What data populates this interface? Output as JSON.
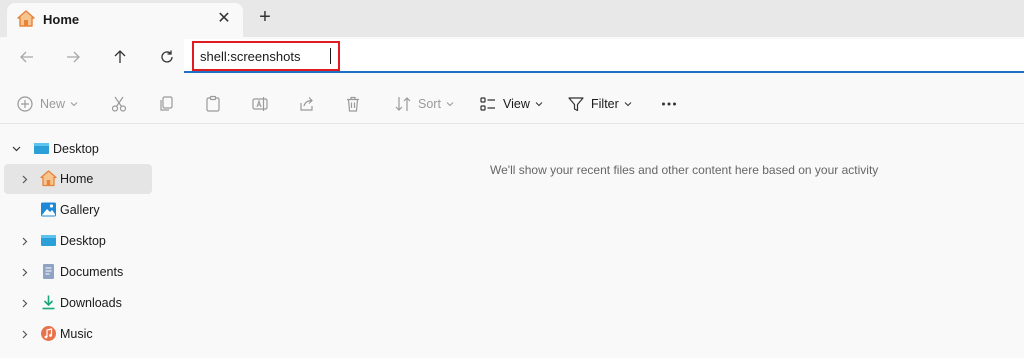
{
  "tab": {
    "title": "Home",
    "close_glyph": "✕",
    "new_tab_glyph": "+"
  },
  "address": {
    "value": "shell:screenshots"
  },
  "commands": {
    "new": "New",
    "sort": "Sort",
    "view": "View",
    "filter": "Filter"
  },
  "sidebar": {
    "root": "Desktop",
    "items": [
      {
        "label": "Home",
        "icon": "home-icon",
        "expandable": true,
        "selected": true
      },
      {
        "label": "Gallery",
        "icon": "gallery-icon",
        "expandable": false
      },
      {
        "label": "Desktop",
        "icon": "desktop-icon",
        "expandable": true
      },
      {
        "label": "Documents",
        "icon": "documents-icon",
        "expandable": true
      },
      {
        "label": "Downloads",
        "icon": "downloads-icon",
        "expandable": true
      },
      {
        "label": "Music",
        "icon": "music-icon",
        "expandable": true
      }
    ]
  },
  "main": {
    "empty_message": "We'll show your recent files and other content here based on your activity"
  },
  "colors": {
    "accent": "#1f6fc2",
    "highlight_border": "#e01b24",
    "home_orange": "#e8833a"
  }
}
